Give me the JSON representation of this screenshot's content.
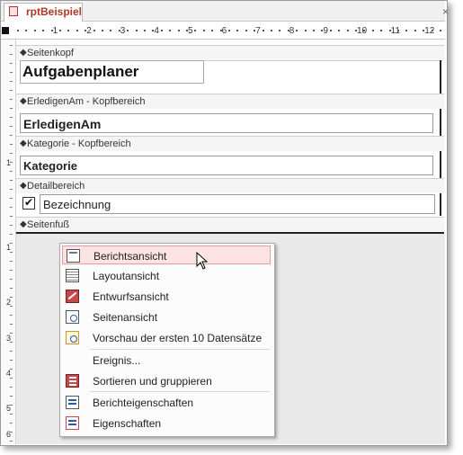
{
  "tab": {
    "title": "rptBeispiel",
    "close": "×"
  },
  "ruler": {
    "numbers": [
      "1",
      "2",
      "3",
      "4",
      "5",
      "6",
      "7",
      "8",
      "9",
      "10",
      "11",
      "12"
    ]
  },
  "vruler": {
    "numbers": [
      "1",
      "1",
      "2",
      "3",
      "4",
      "5",
      "6"
    ]
  },
  "bands": {
    "page_header": "Seitenkopf",
    "erledigen_header": "ErledigenAm - Kopfbereich",
    "kategorie_header": "Kategorie - Kopfbereich",
    "detail": "Detailbereich",
    "page_footer": "Seitenfuß"
  },
  "controls": {
    "title_label": "Aufgabenplaner",
    "erledigen_field": "ErledigenAm",
    "kategorie_field": "Kategorie",
    "bezeichnung_field": "Bezeichnung",
    "check_mark": "✔"
  },
  "band_arrow": "◆",
  "menu": {
    "items": [
      {
        "label": "Berichtsansicht",
        "icon": "report-view-icon"
      },
      {
        "label": "Layoutansicht",
        "icon": "layout-view-icon"
      },
      {
        "label": "Entwurfsansicht",
        "icon": "design-view-icon"
      },
      {
        "label": "Seitenansicht",
        "icon": "print-preview-icon"
      },
      {
        "label": "Vorschau der ersten 10 Datensätze",
        "icon": "preview-records-icon"
      },
      {
        "label": "Ereignis...",
        "icon": ""
      },
      {
        "label": "Sortieren und gruppieren",
        "icon": "sort-group-icon"
      },
      {
        "label": "Berichteigenschaften",
        "icon": "report-properties-icon"
      },
      {
        "label": "Eigenschaften",
        "icon": "properties-icon"
      }
    ]
  },
  "colors": {
    "accent": "#b0362c",
    "highlight": "#fbe3e4"
  }
}
